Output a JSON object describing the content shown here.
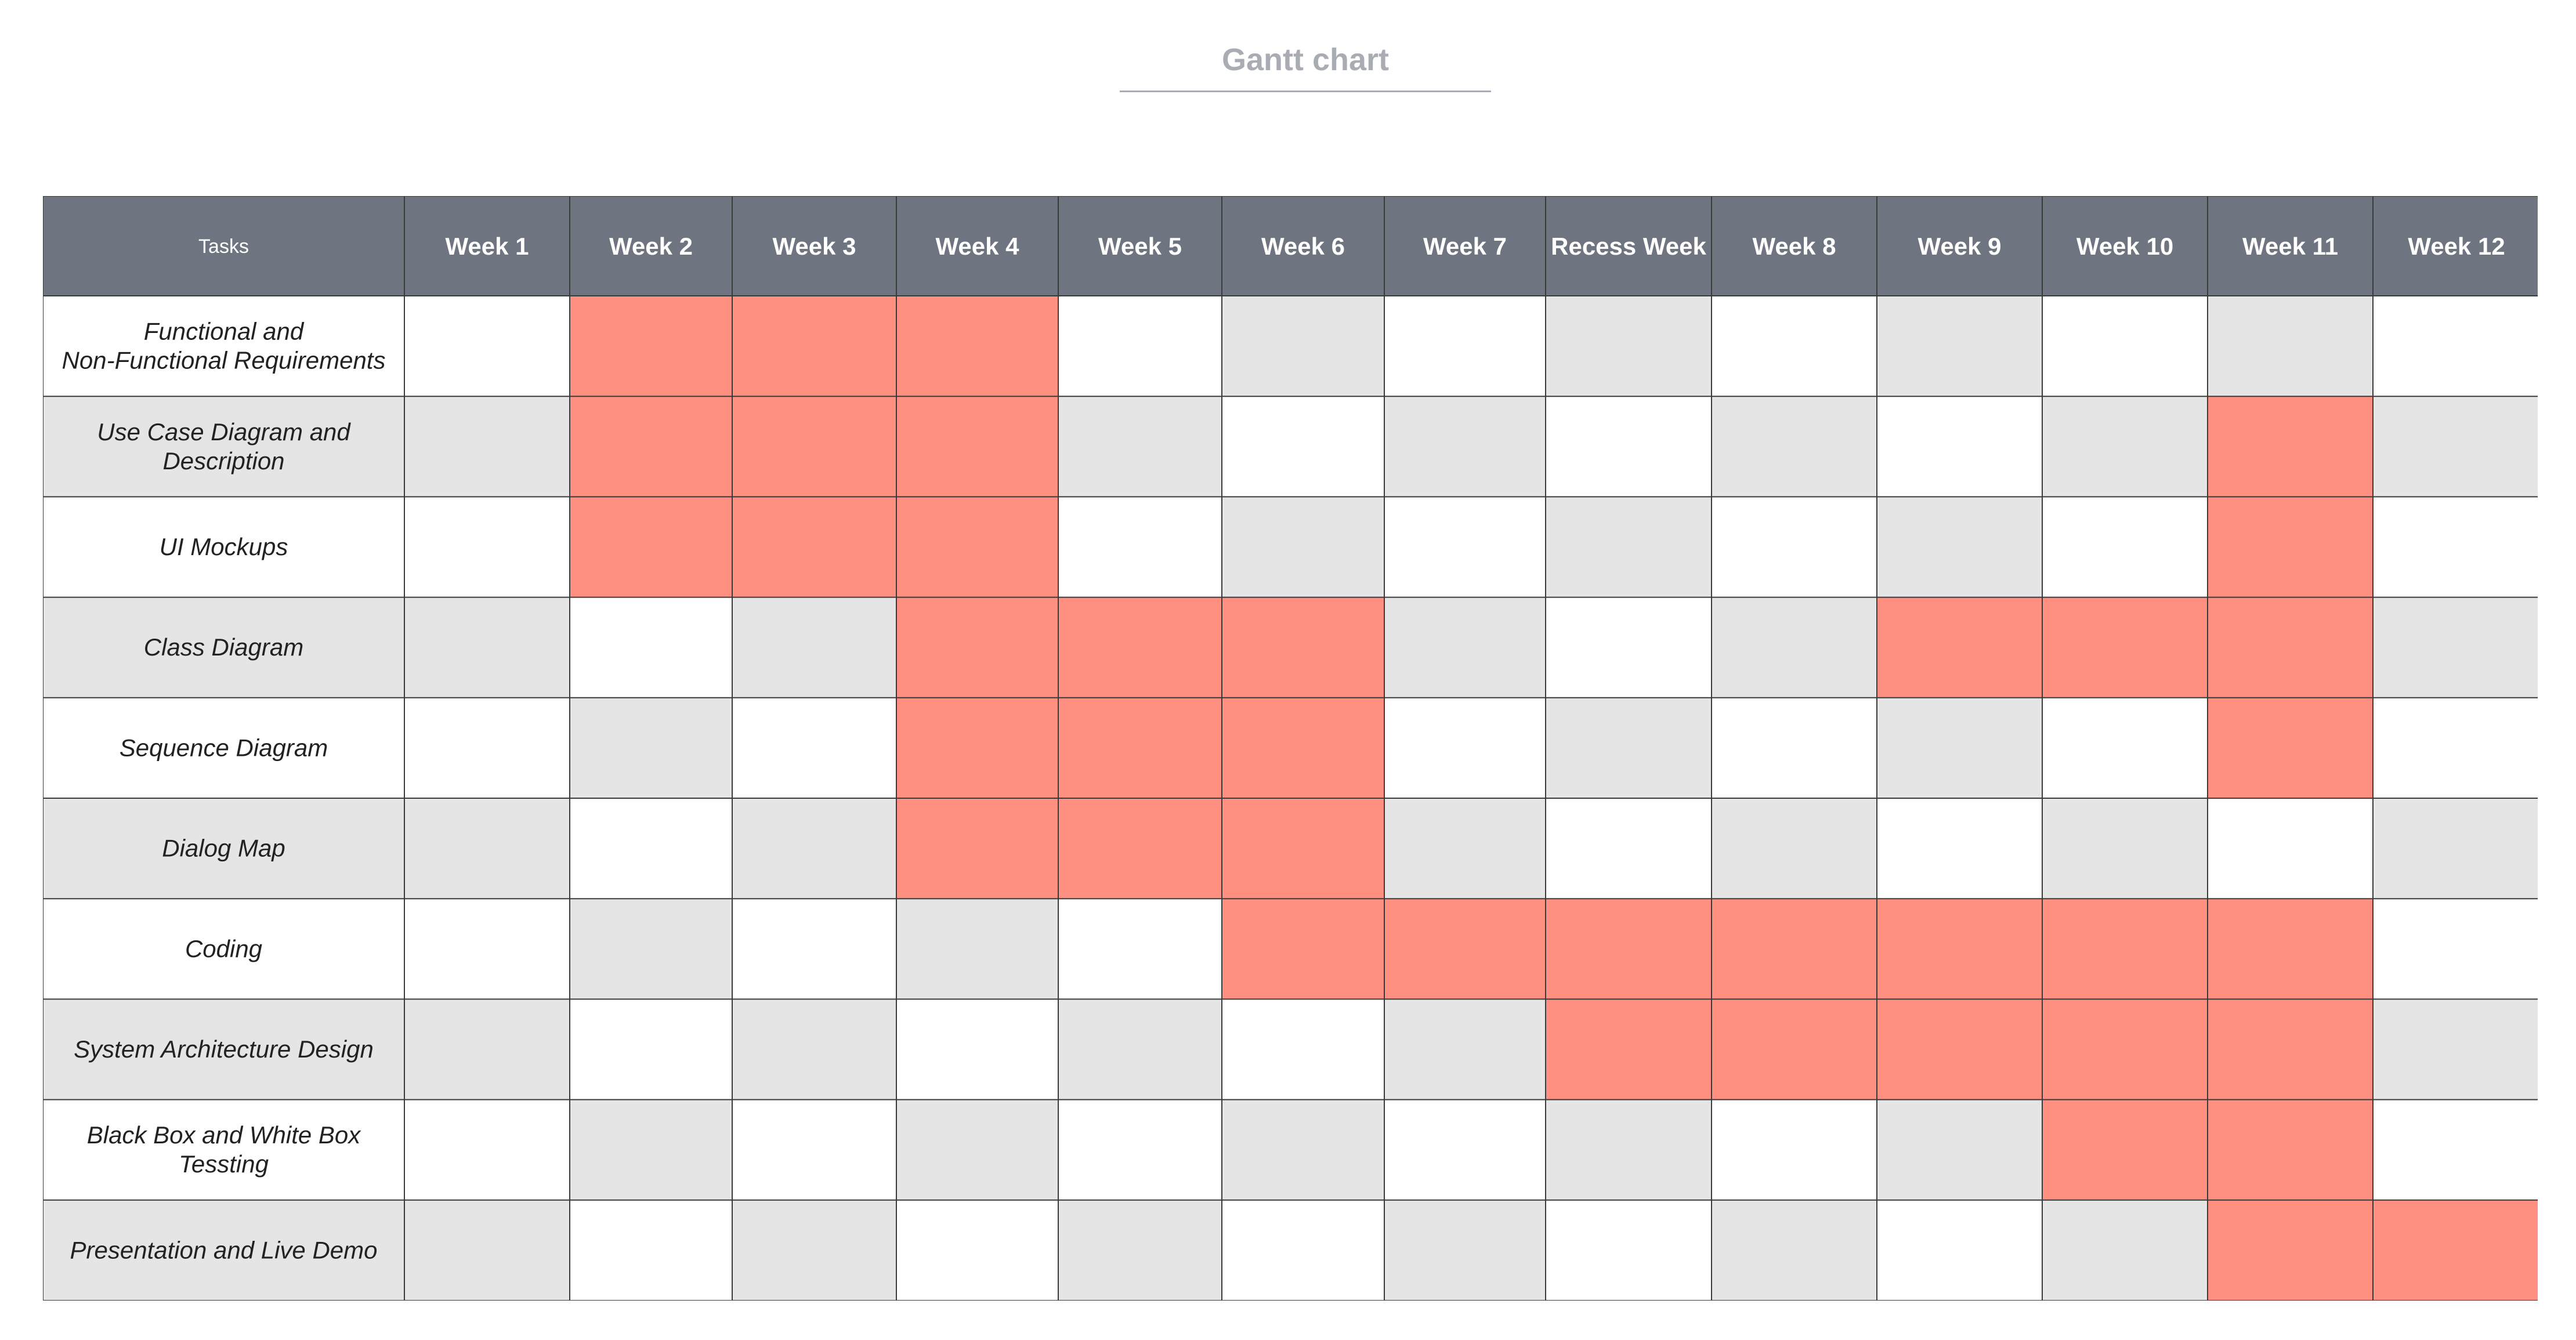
{
  "chart_data": {
    "type": "table",
    "title": "Gantt chart",
    "task_header": "Tasks",
    "weeks": [
      "Week 1",
      "Week 2",
      "Week 3",
      "Week 4",
      "Week 5",
      "Week 6",
      "Week 7",
      "Recess Week",
      "Week 8",
      "Week 9",
      "Week 10",
      "Week 11",
      "Week  12"
    ],
    "tasks": [
      {
        "name": [
          "Functional and",
          "Non-Functional Requirements"
        ],
        "active_weeks": [
          "Week 2",
          "Week 3",
          "Week 4"
        ]
      },
      {
        "name": [
          "Use Case Diagram and",
          "Description"
        ],
        "active_weeks": [
          "Week 2",
          "Week 3",
          "Week 4",
          "Week 11"
        ]
      },
      {
        "name": [
          "UI Mockups"
        ],
        "active_weeks": [
          "Week 2",
          "Week 3",
          "Week 4",
          "Week 11"
        ]
      },
      {
        "name": [
          "Class Diagram"
        ],
        "active_weeks": [
          "Week 4",
          "Week 5",
          "Week 6",
          "Week 9",
          "Week 10",
          "Week 11"
        ]
      },
      {
        "name": [
          "Sequence Diagram"
        ],
        "active_weeks": [
          "Week 4",
          "Week 5",
          "Week 6",
          "Week 11"
        ]
      },
      {
        "name": [
          "Dialog Map"
        ],
        "active_weeks": [
          "Week 4",
          "Week 5",
          "Week 6"
        ]
      },
      {
        "name": [
          "Coding"
        ],
        "active_weeks": [
          "Week 6",
          "Week 7",
          "Recess Week",
          "Week 8",
          "Week 9",
          "Week 10",
          "Week 11"
        ]
      },
      {
        "name": [
          "System Architecture Design"
        ],
        "active_weeks": [
          "Recess Week",
          "Week 8",
          "Week 9",
          "Week 10",
          "Week 11"
        ]
      },
      {
        "name": [
          "Black Box and White Box",
          "Tessting"
        ],
        "active_weeks": [
          "Week 10",
          "Week 11"
        ]
      },
      {
        "name": [
          "Presentation and Live Demo"
        ],
        "active_weeks": [
          "Week 11",
          "Week  12"
        ]
      }
    ],
    "colors": {
      "header_bg": "#6e7580",
      "header_text": "#ffffff",
      "active": "#ff8f80",
      "shade": "#e5e5e5",
      "plain": "#ffffff",
      "grid": "#3a3a3a",
      "task_text": "#222222",
      "title_text": "#a9adb3"
    }
  }
}
